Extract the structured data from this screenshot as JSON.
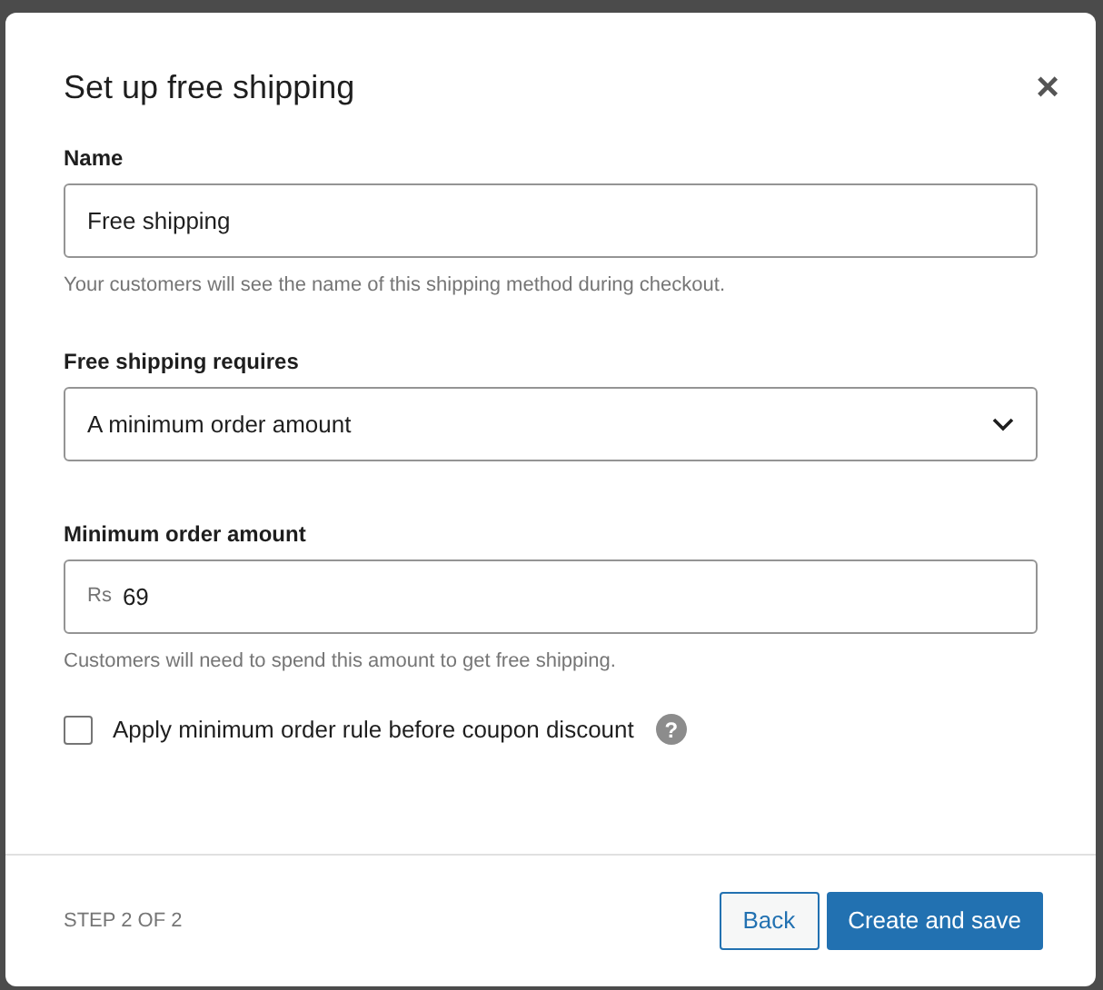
{
  "dialog": {
    "title": "Set up free shipping",
    "close": "×"
  },
  "name_field": {
    "label": "Name",
    "value": "Free shipping",
    "help": "Your customers will see the name of this shipping method during checkout."
  },
  "requires_field": {
    "label": "Free shipping requires",
    "value": "A minimum order amount"
  },
  "amount_field": {
    "label": "Minimum order amount",
    "prefix": "Rs",
    "value": "69",
    "help": "Customers will need to spend this amount to get free shipping."
  },
  "coupon_option": {
    "label": "Apply minimum order rule before coupon discount",
    "checked": false,
    "help_icon": "?"
  },
  "footer": {
    "step": "STEP 2 OF 2",
    "buttons": [
      {
        "label": "Back",
        "kind": "secondary"
      },
      {
        "label": "Create and save",
        "kind": "primary"
      }
    ]
  }
}
